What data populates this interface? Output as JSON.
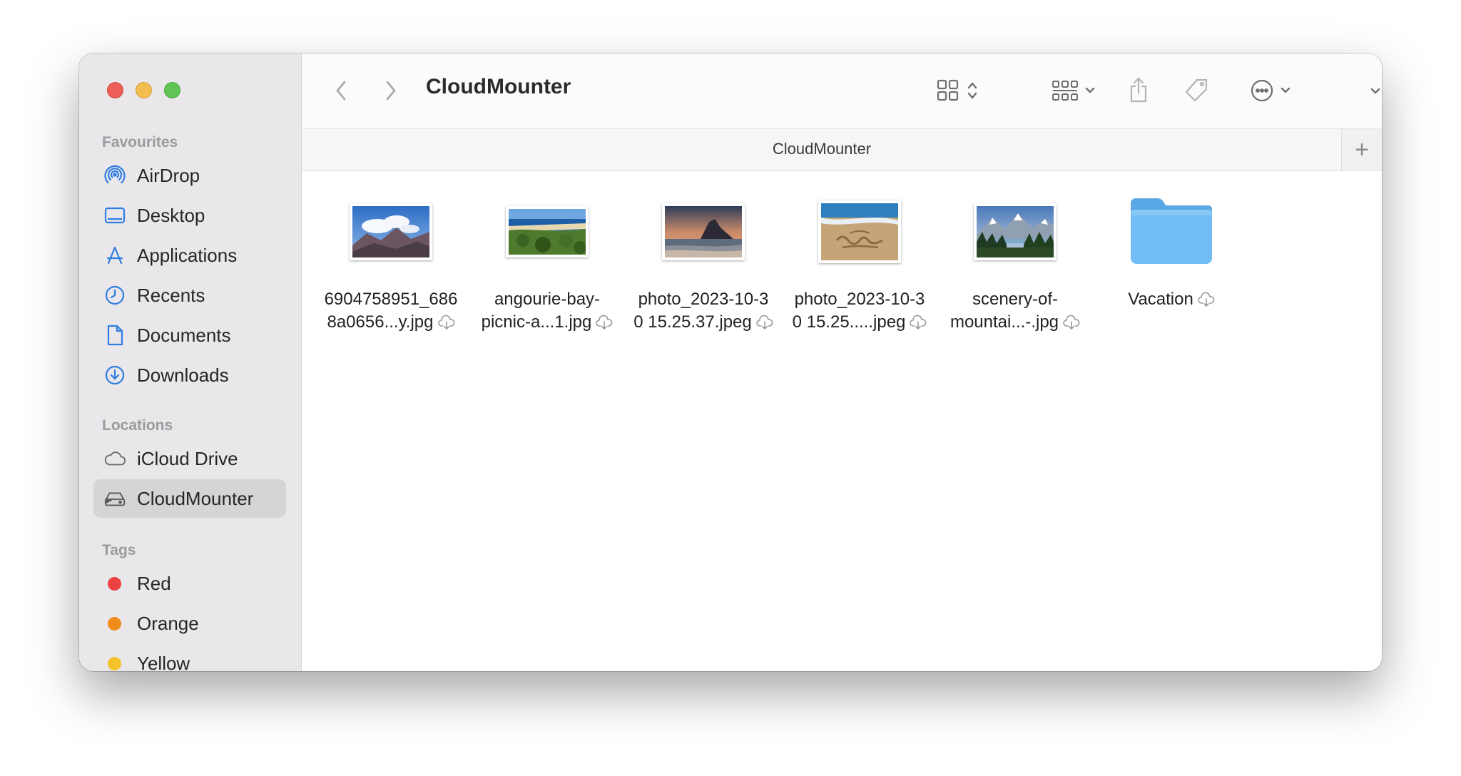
{
  "window": {
    "title": "CloudMounter",
    "path_title": "CloudMounter",
    "add_tab_label": "+"
  },
  "sidebar": {
    "favourites_label": "Favourites",
    "favourites": [
      {
        "label": "AirDrop",
        "icon": "airdrop-icon"
      },
      {
        "label": "Desktop",
        "icon": "desktop-icon"
      },
      {
        "label": "Applications",
        "icon": "applications-icon"
      },
      {
        "label": "Recents",
        "icon": "clock-icon"
      },
      {
        "label": "Documents",
        "icon": "document-icon"
      },
      {
        "label": "Downloads",
        "icon": "download-icon"
      }
    ],
    "locations_label": "Locations",
    "locations": [
      {
        "label": "iCloud Drive",
        "icon": "cloud-icon"
      },
      {
        "label": "CloudMounter",
        "icon": "drive-icon",
        "selected": true
      }
    ],
    "tags_label": "Tags",
    "tags": [
      {
        "label": "Red",
        "color": "#ec4141"
      },
      {
        "label": "Orange",
        "color": "#f08c1c"
      },
      {
        "label": "Yellow",
        "color": "#f3c22b"
      }
    ]
  },
  "files": [
    {
      "line1": "6904758951_686",
      "line2": "8a0656...y.jpg",
      "kind": "image",
      "scene": "mountains-clouds"
    },
    {
      "line1": "angourie-bay-",
      "line2": "picnic-a...1.jpg",
      "kind": "image",
      "scene": "coast-bay"
    },
    {
      "line1": "photo_2023-10-3",
      "line2": "0 15.25.37.jpeg",
      "kind": "image",
      "scene": "sunset-beach"
    },
    {
      "line1": "photo_2023-10-3",
      "line2": "0 15.25.....jpeg",
      "kind": "image",
      "scene": "sand-writing"
    },
    {
      "line1": "scenery-of-",
      "line2": "mountai...-.jpg",
      "kind": "image",
      "scene": "alpine-valley"
    },
    {
      "line1": "Vacation",
      "line2": "",
      "kind": "folder",
      "scene": "folder"
    }
  ],
  "colors": {
    "accent": "#2f7de1",
    "folder": "#67b5f0"
  }
}
